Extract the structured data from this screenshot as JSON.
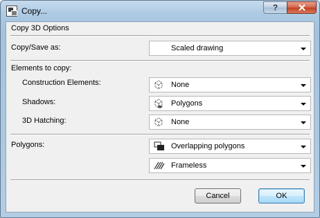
{
  "window": {
    "title": "Copy..."
  },
  "titlebar": {
    "help_symbol": "?",
    "close_symbol": "x"
  },
  "header": {
    "label": "Copy 3D Options"
  },
  "copy_save": {
    "label": "Copy/Save as:",
    "value": "Scaled drawing"
  },
  "elements": {
    "label": "Elements to copy:"
  },
  "construction": {
    "label": "Construction Elements:",
    "value": "None",
    "icon": "dotted-box-icon"
  },
  "shadows": {
    "label": "Shadows:",
    "value": "Polygons",
    "icon": "shadow-polygon-icon"
  },
  "hatching": {
    "label": "3D Hatching:",
    "value": "None",
    "icon": "dotted-box-icon"
  },
  "polygons": {
    "label": "Polygons:",
    "value": "Overlapping polygons",
    "icon": "overlapping-polygons-icon"
  },
  "frame": {
    "value": "Frameless",
    "icon": "hatched-frame-icon"
  },
  "buttons": {
    "cancel": "Cancel",
    "ok": "OK"
  }
}
